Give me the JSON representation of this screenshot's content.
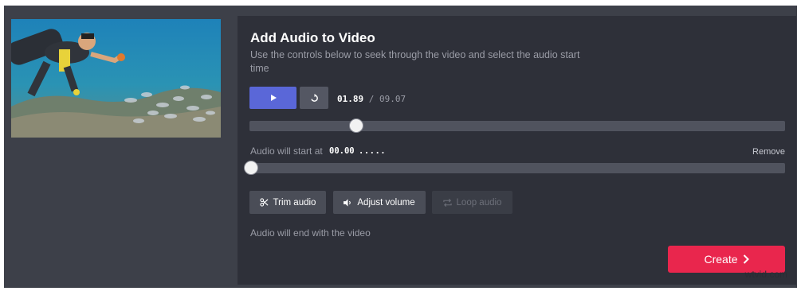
{
  "editor": {
    "title": "Add Audio to Video",
    "subtitle": "Use the controls below to seek through the video and select the audio start time"
  },
  "playback": {
    "current_time": "01.89",
    "separator": "/",
    "duration": "09.07",
    "progress_fraction": 0.2
  },
  "audio": {
    "start_label": "Audio will start at",
    "start_value": "00.00",
    "start_dots": ".....",
    "remove_label": "Remove",
    "start_fraction": 0.0,
    "end_text": "Audio will end with the video"
  },
  "tools": {
    "trim_label": "Trim audio",
    "volume_label": "Adjust volume",
    "loop_label": "Loop audio"
  },
  "create_label": "Create",
  "watermark": "wtvid.com",
  "colors": {
    "accent_play": "#5a67d8",
    "create_button": "#e9264d"
  },
  "icons": [
    "play-icon",
    "replay-icon",
    "scissors-icon",
    "volume-icon",
    "loop-icon",
    "chevron-right-icon"
  ]
}
